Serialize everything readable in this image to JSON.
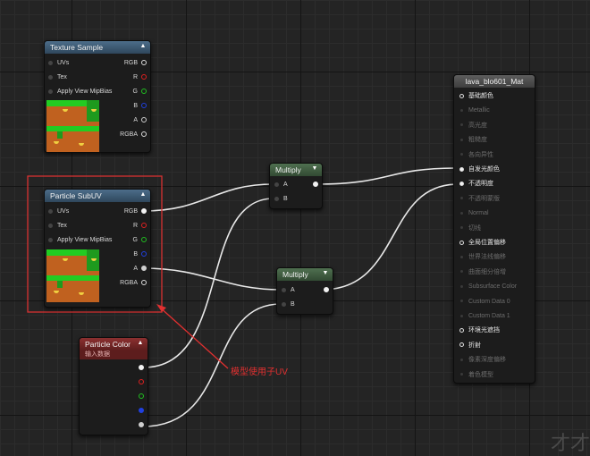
{
  "texture_sample": {
    "title": "Texture Sample",
    "inputs": [
      "UVs",
      "Tex",
      "Apply View MipBias"
    ],
    "outputs": [
      "RGB",
      "R",
      "G",
      "B",
      "A",
      "RGBA"
    ]
  },
  "particle_subuv": {
    "title": "Particle SubUV",
    "inputs": [
      "UVs",
      "Tex",
      "Apply View MipBias"
    ],
    "outputs": [
      "RGB",
      "R",
      "G",
      "B",
      "A",
      "RGBA"
    ]
  },
  "multiply_1": {
    "title": "Multiply",
    "inputs": [
      "A",
      "B"
    ]
  },
  "multiply_2": {
    "title": "Multiply",
    "inputs": [
      "A",
      "B"
    ]
  },
  "particle_color": {
    "title": "Particle Color",
    "subtitle": "输入数据"
  },
  "material": {
    "title": "lava_blo601_Mat",
    "pins": [
      {
        "label": "基础颜色",
        "active": true
      },
      {
        "label": "Metallic",
        "active": false
      },
      {
        "label": "高光度",
        "active": false
      },
      {
        "label": "粗糙度",
        "active": false
      },
      {
        "label": "各向异性",
        "active": false
      },
      {
        "label": "自发光颜色",
        "active": true
      },
      {
        "label": "不透明度",
        "active": true
      },
      {
        "label": "不透明蒙版",
        "active": false
      },
      {
        "label": "Normal",
        "active": false
      },
      {
        "label": "切线",
        "active": false
      },
      {
        "label": "全局位置偏移",
        "active": true
      },
      {
        "label": "世界法线偏移",
        "active": false
      },
      {
        "label": "曲面细分倍增",
        "active": false
      },
      {
        "label": "Subsurface Color",
        "active": false
      },
      {
        "label": "Custom Data 0",
        "active": false
      },
      {
        "label": "Custom Data 1",
        "active": false
      },
      {
        "label": "环境光遮挡",
        "active": true
      },
      {
        "label": "折射",
        "active": true
      },
      {
        "label": "像素深度偏移",
        "active": false
      },
      {
        "label": "着色模型",
        "active": false
      }
    ]
  },
  "annotation": {
    "text": "模型使用子UV",
    "color": "#e23030"
  },
  "watermark": "才才"
}
